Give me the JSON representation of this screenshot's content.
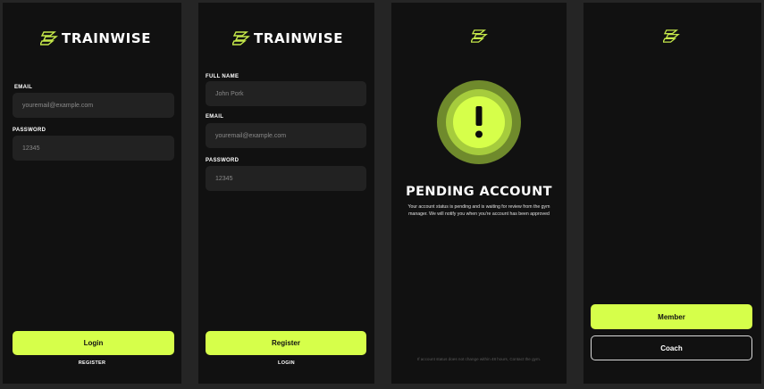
{
  "brand": {
    "name": "TRAINWISE",
    "accent": "#d6ff4a"
  },
  "login": {
    "email_label": "EMAIL",
    "email_placeholder": "youremail@example.com",
    "password_label": "PASSWORD",
    "password_placeholder": "12345",
    "submit_label": "Login",
    "alt_link": "REGISTER"
  },
  "register": {
    "name_label": "FULL NAME",
    "name_placeholder": "John Pork",
    "email_label": "EMAIL",
    "email_placeholder": "youremail@example.com",
    "password_label": "PASSWORD",
    "password_placeholder": "12345",
    "submit_label": "Register",
    "alt_link": "LOGIN"
  },
  "pending": {
    "icon": "exclamation-icon",
    "title": "PENDING ACCOUNT",
    "message": "Your account status is pending and is waiting for review from the gym manager. We will notify you when you're account has been approved",
    "footnote": "If account status does not change within 48 hours, Contact the gym."
  },
  "role_select": {
    "member_label": "Member",
    "coach_label": "Coach"
  }
}
